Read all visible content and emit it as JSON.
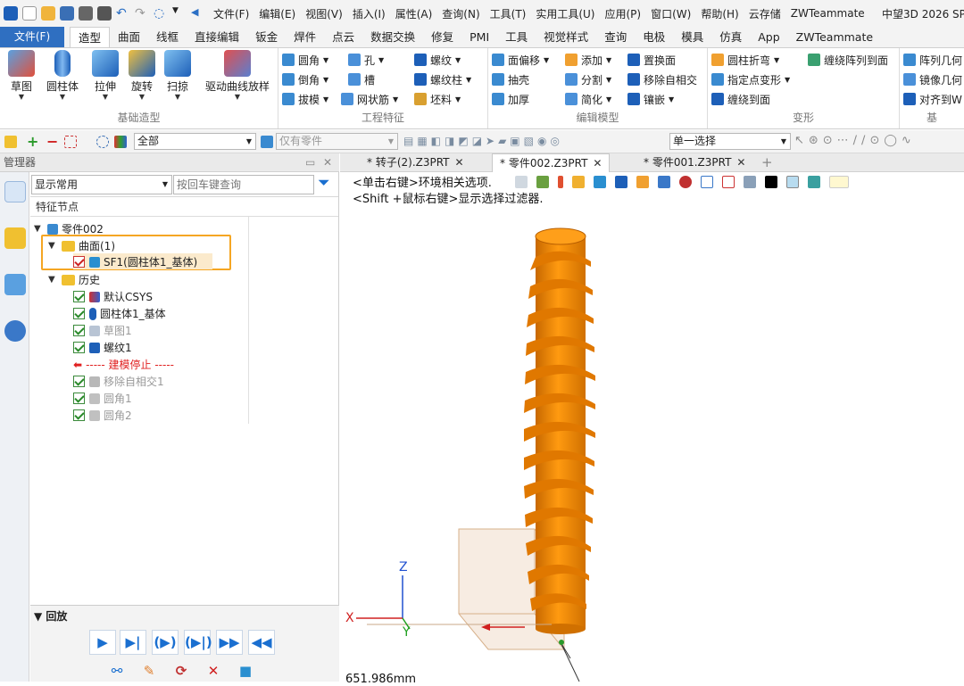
{
  "app_title": "中望3D 2026 SP",
  "menus": [
    "文件(F)",
    "编辑(E)",
    "视图(V)",
    "插入(I)",
    "属性(A)",
    "查询(N)",
    "工具(T)",
    "实用工具(U)",
    "应用(P)",
    "窗口(W)",
    "帮助(H)",
    "云存储",
    "ZWTeammate"
  ],
  "file_tab": "文件(F)",
  "ribbon_tabs": [
    "造型",
    "曲面",
    "线框",
    "直接编辑",
    "钣金",
    "焊件",
    "点云",
    "数据交换",
    "修复",
    "PMI",
    "工具",
    "视觉样式",
    "查询",
    "电极",
    "模具",
    "仿真",
    "App",
    "ZWTeammate"
  ],
  "active_tab": "造型",
  "groups": {
    "basic": {
      "label": "基础造型",
      "buttons": [
        "草图",
        "圆柱体",
        "拉伸",
        "旋转",
        "扫掠",
        "驱动曲线放样"
      ]
    },
    "eng": {
      "label": "工程特征",
      "items": [
        "圆角",
        "孔",
        "螺纹",
        "倒角",
        "槽",
        "螺纹柱",
        "拔模",
        "网状筋",
        "坯料"
      ]
    },
    "edit": {
      "label": "编辑模型",
      "items": [
        "面偏移",
        "添加",
        "置换面",
        "抽壳",
        "分割",
        "移除自相交",
        "加厚",
        "简化",
        "镶嵌"
      ]
    },
    "transform": {
      "label": "变形",
      "items": [
        "圆柱折弯",
        "缠绕阵列到面",
        "指定点变形",
        "缠绕到面"
      ]
    },
    "base": {
      "label": "基",
      "items": [
        "阵列几何",
        "镜像几何",
        "对齐到W"
      ]
    }
  },
  "filter_all": "全部",
  "filter_parts": "仅有零件",
  "select_mode": "单一选择",
  "manager": {
    "title": "管理器",
    "show_common": "显示常用",
    "search_placeholder": "按回车键查询",
    "feature_header": "特征节点",
    "tree": [
      {
        "label": "零件002",
        "level": 0
      },
      {
        "label": "曲面(1)",
        "level": 1
      },
      {
        "label": "SF1(圆柱体1_基体)",
        "level": 2
      },
      {
        "label": "历史",
        "level": 1
      },
      {
        "label": "默认CSYS",
        "level": 2
      },
      {
        "label": "圆柱体1_基体",
        "level": 2
      },
      {
        "label": "草图1",
        "level": 2
      },
      {
        "label": "螺纹1",
        "level": 2
      },
      {
        "label": "----- 建模停止 -----",
        "level": 2
      },
      {
        "label": "移除自相交1",
        "level": 2
      },
      {
        "label": "圆角1",
        "level": 2
      },
      {
        "label": "圆角2",
        "level": 2
      }
    ],
    "playback": "▼ 回放"
  },
  "doc_tabs": [
    {
      "label": "* 转子(2).Z3PRT",
      "active": false
    },
    {
      "label": "* 零件002.Z3PRT",
      "active": true
    },
    {
      "label": "* 零件001.Z3PRT",
      "active": false
    }
  ],
  "hints": [
    "<单击右键>环境相关选项.",
    "<Shift +鼠标右键>显示选择过滤器."
  ],
  "axis": {
    "z": "Z",
    "x": "X",
    "y": "Y"
  },
  "measure": "651.986mm",
  "colors": {
    "accent": "#2f6fc1",
    "part": "#f08a00",
    "highlight": "#f5a623"
  }
}
